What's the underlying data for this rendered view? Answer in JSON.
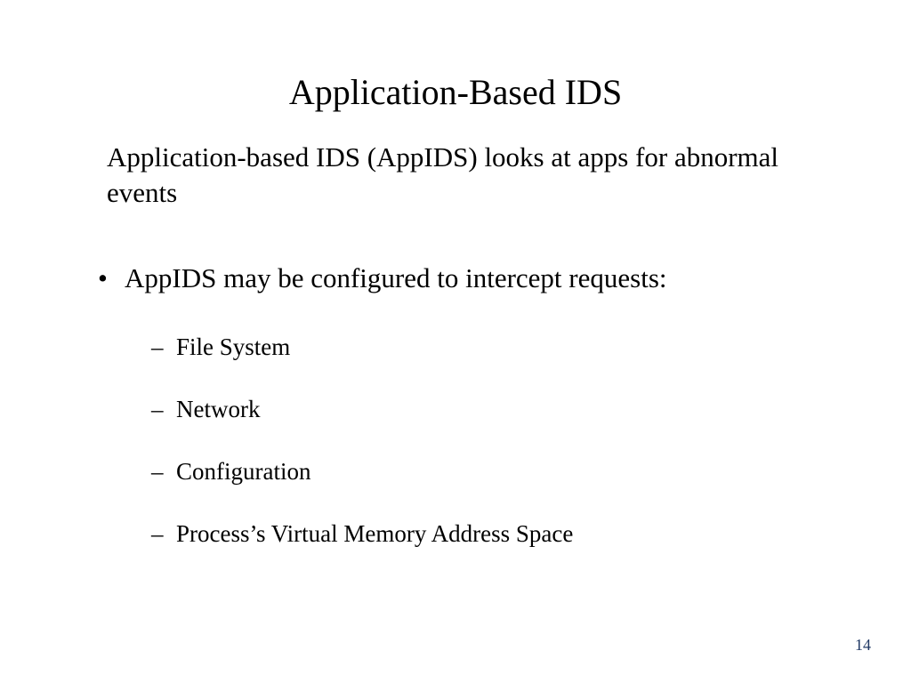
{
  "slide": {
    "title": "Application-Based IDS",
    "intro": "Application-based IDS (AppIDS) looks at apps for abnormal events",
    "bullet_main": "AppIDS may be configured to intercept requests:",
    "sub_items": [
      "File System",
      "Network",
      "Configuration",
      "Process’s Virtual Memory Address Space"
    ],
    "page_number": "14"
  }
}
